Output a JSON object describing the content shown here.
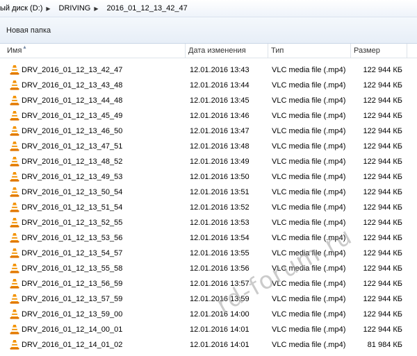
{
  "breadcrumb": {
    "items": [
      {
        "label": "ый диск (D:)"
      },
      {
        "label": "DRIVING"
      },
      {
        "label": "2016_01_12_13_42_47"
      }
    ]
  },
  "toolbar": {
    "new_folder_label": "Новая папка"
  },
  "columns": {
    "name": "Имя",
    "date": "Дата изменения",
    "type": "Тип",
    "size": "Размер"
  },
  "icons": {
    "file_icon": "vlc-cone-icon",
    "sort_icon": "sort-ascending-icon"
  },
  "colors": {
    "vlc_orange": "#f08a00"
  },
  "files": [
    {
      "name": "DRV_2016_01_12_13_42_47",
      "date": "12.01.2016 13:43",
      "type": "VLC media file (.mp4)",
      "size": "122 944 КБ"
    },
    {
      "name": "DRV_2016_01_12_13_43_48",
      "date": "12.01.2016 13:44",
      "type": "VLC media file (.mp4)",
      "size": "122 944 КБ"
    },
    {
      "name": "DRV_2016_01_12_13_44_48",
      "date": "12.01.2016 13:45",
      "type": "VLC media file (.mp4)",
      "size": "122 944 КБ"
    },
    {
      "name": "DRV_2016_01_12_13_45_49",
      "date": "12.01.2016 13:46",
      "type": "VLC media file (.mp4)",
      "size": "122 944 КБ"
    },
    {
      "name": "DRV_2016_01_12_13_46_50",
      "date": "12.01.2016 13:47",
      "type": "VLC media file (.mp4)",
      "size": "122 944 КБ"
    },
    {
      "name": "DRV_2016_01_12_13_47_51",
      "date": "12.01.2016 13:48",
      "type": "VLC media file (.mp4)",
      "size": "122 944 КБ"
    },
    {
      "name": "DRV_2016_01_12_13_48_52",
      "date": "12.01.2016 13:49",
      "type": "VLC media file (.mp4)",
      "size": "122 944 КБ"
    },
    {
      "name": "DRV_2016_01_12_13_49_53",
      "date": "12.01.2016 13:50",
      "type": "VLC media file (.mp4)",
      "size": "122 944 КБ"
    },
    {
      "name": "DRV_2016_01_12_13_50_54",
      "date": "12.01.2016 13:51",
      "type": "VLC media file (.mp4)",
      "size": "122 944 КБ"
    },
    {
      "name": "DRV_2016_01_12_13_51_54",
      "date": "12.01.2016 13:52",
      "type": "VLC media file (.mp4)",
      "size": "122 944 КБ"
    },
    {
      "name": "DRV_2016_01_12_13_52_55",
      "date": "12.01.2016 13:53",
      "type": "VLC media file (.mp4)",
      "size": "122 944 КБ"
    },
    {
      "name": "DRV_2016_01_12_13_53_56",
      "date": "12.01.2016 13:54",
      "type": "VLC media file (.mp4)",
      "size": "122 944 КБ"
    },
    {
      "name": "DRV_2016_01_12_13_54_57",
      "date": "12.01.2016 13:55",
      "type": "VLC media file (.mp4)",
      "size": "122 944 КБ"
    },
    {
      "name": "DRV_2016_01_12_13_55_58",
      "date": "12.01.2016 13:56",
      "type": "VLC media file (.mp4)",
      "size": "122 944 КБ"
    },
    {
      "name": "DRV_2016_01_12_13_56_59",
      "date": "12.01.2016 13:57",
      "type": "VLC media file (.mp4)",
      "size": "122 944 КБ"
    },
    {
      "name": "DRV_2016_01_12_13_57_59",
      "date": "12.01.2016 13:59",
      "type": "VLC media file (.mp4)",
      "size": "122 944 КБ"
    },
    {
      "name": "DRV_2016_01_12_13_59_00",
      "date": "12.01.2016 14:00",
      "type": "VLC media file (.mp4)",
      "size": "122 944 КБ"
    },
    {
      "name": "DRV_2016_01_12_14_00_01",
      "date": "12.01.2016 14:01",
      "type": "VLC media file (.mp4)",
      "size": "122 944 КБ"
    },
    {
      "name": "DRV_2016_01_12_14_01_02",
      "date": "12.01.2016 14:01",
      "type": "VLC media file (.mp4)",
      "size": "81 984 КБ"
    }
  ],
  "watermark": "rd-forum.ru"
}
